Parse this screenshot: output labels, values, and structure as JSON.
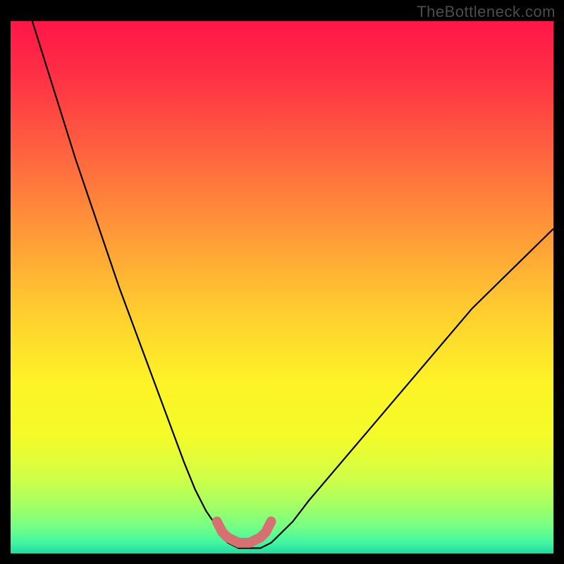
{
  "attribution": "TheBottleneck.com",
  "chart_data": {
    "type": "line",
    "title": "",
    "xlabel": "",
    "ylabel": "",
    "xlim": [
      0,
      100
    ],
    "ylim": [
      0,
      100
    ],
    "background": "vertical-gradient red→yellow→green",
    "series": [
      {
        "name": "bottleneck-curve-left",
        "x": [
          4,
          8,
          12,
          16,
          20,
          24,
          28,
          32,
          34,
          36,
          38,
          39,
          40
        ],
        "values": [
          100,
          87,
          74,
          62,
          50,
          39,
          28,
          17,
          12,
          8,
          5,
          3,
          2
        ]
      },
      {
        "name": "bottleneck-curve-right",
        "x": [
          48,
          49,
          50,
          52,
          55,
          60,
          65,
          70,
          75,
          80,
          85,
          90,
          95,
          100
        ],
        "values": [
          2,
          3,
          4,
          6,
          10,
          16,
          22,
          28,
          34,
          40,
          46,
          51,
          56,
          61
        ]
      },
      {
        "name": "bottleneck-floor",
        "x": [
          40,
          42,
          44,
          46,
          48
        ],
        "values": [
          2,
          1,
          1,
          1,
          2
        ]
      }
    ],
    "markers": {
      "name": "selected-range",
      "x": [
        38,
        39,
        40,
        42,
        44,
        46,
        47,
        48
      ],
      "values": [
        6,
        4,
        3,
        2,
        2,
        3,
        4,
        6
      ]
    },
    "gradient_stops": [
      {
        "offset": 0.0,
        "color": "#ff1648"
      },
      {
        "offset": 0.1,
        "color": "#ff2f45"
      },
      {
        "offset": 0.25,
        "color": "#ff643f"
      },
      {
        "offset": 0.4,
        "color": "#ff9a38"
      },
      {
        "offset": 0.55,
        "color": "#ffcf2f"
      },
      {
        "offset": 0.68,
        "color": "#fdf327"
      },
      {
        "offset": 0.78,
        "color": "#f4fb29"
      },
      {
        "offset": 0.86,
        "color": "#cfff48"
      },
      {
        "offset": 0.91,
        "color": "#a4ff64"
      },
      {
        "offset": 0.95,
        "color": "#74ff85"
      },
      {
        "offset": 0.98,
        "color": "#41f6a2"
      },
      {
        "offset": 1.0,
        "color": "#23d9a3"
      }
    ]
  }
}
